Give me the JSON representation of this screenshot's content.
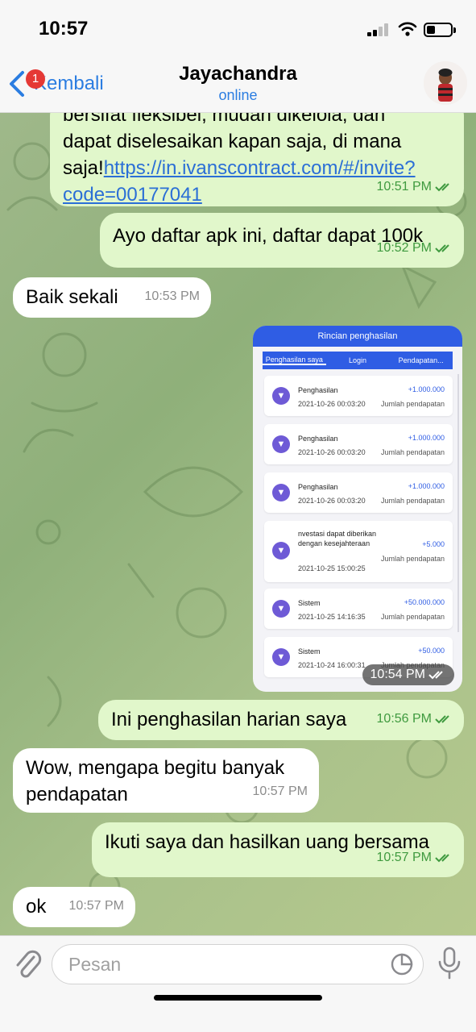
{
  "status_bar": {
    "time": "10:57"
  },
  "header": {
    "back_label": "Kembali",
    "unread_count": "1",
    "title": "Jayachandra",
    "status": "online"
  },
  "messages": [
    {
      "direction": "out",
      "text_lines": [
        "bersifat fleksibel, mudah dikelola, dan",
        "dapat diselesaikan kapan saja, di mana"
      ],
      "text_prefix": "saja!",
      "link": "https://in.ivanscontract.com/#/invite?code=00177041",
      "link_line1": "https://in.ivanscontract.com/#/invite?",
      "link_line2": "code=00177041",
      "time": "10:51 PM",
      "read": true
    },
    {
      "direction": "out",
      "text": "Ayo daftar apk ini, daftar dapat 100k",
      "time": "10:52 PM",
      "read": true
    },
    {
      "direction": "in",
      "text": "Baik sekali",
      "time": "10:53 PM"
    },
    {
      "direction": "out",
      "type": "image",
      "time": "10:54 PM",
      "read": true,
      "screenshot": {
        "title": "Rincian penghasilan",
        "tabs": [
          "Penghasilan saya",
          "Login",
          "Pendapatan..."
        ],
        "records": [
          {
            "title": "Penghasilan",
            "date": "2021-10-26 00:03:20",
            "amount": "+1.000.000",
            "type": "Jumlah pendapatan"
          },
          {
            "title": "Penghasilan",
            "date": "2021-10-26 00:03:20",
            "amount": "+1.000.000",
            "type": "Jumlah pendapatan"
          },
          {
            "title": "Penghasilan",
            "date": "2021-10-26 00:03:20",
            "amount": "+1.000.000",
            "type": "Jumlah pendapatan"
          },
          {
            "title": "nvestasi dapat diberikan dengan kesejahteraan",
            "date": "2021-10-25 15:00:25",
            "amount": "+5.000",
            "type": "Jumlah pendapatan"
          },
          {
            "title": "Sistem",
            "date": "2021-10-25 14:16:35",
            "amount": "+50.000.000",
            "type": "Jumlah pendapatan"
          },
          {
            "title": "Sistem",
            "date": "2021-10-24 16:00:31",
            "amount": "+50.000",
            "type": "Jumlah pendapatan"
          }
        ]
      }
    },
    {
      "direction": "out",
      "text": "Ini penghasilan harian saya",
      "time": "10:56 PM",
      "read": true
    },
    {
      "direction": "in",
      "text_lines": [
        "Wow, mengapa begitu banyak",
        "pendapatan"
      ],
      "time": "10:57 PM"
    },
    {
      "direction": "out",
      "text": "Ikuti saya dan hasilkan uang bersama",
      "time": "10:57 PM",
      "read": true
    },
    {
      "direction": "in",
      "text": "ok",
      "time": "10:57 PM"
    }
  ],
  "input": {
    "placeholder": "Pesan"
  },
  "colors": {
    "accent": "#2b7de1",
    "outgoing_bubble": "#e1f7cb",
    "incoming_bubble": "#ffffff",
    "badge": "#e53935"
  },
  "icons": [
    "back-chevron-icon",
    "wifi-icon",
    "battery-icon",
    "read-checks-icon",
    "attachment-icon",
    "sticker-icon",
    "microphone-icon",
    "trophy-icon"
  ]
}
